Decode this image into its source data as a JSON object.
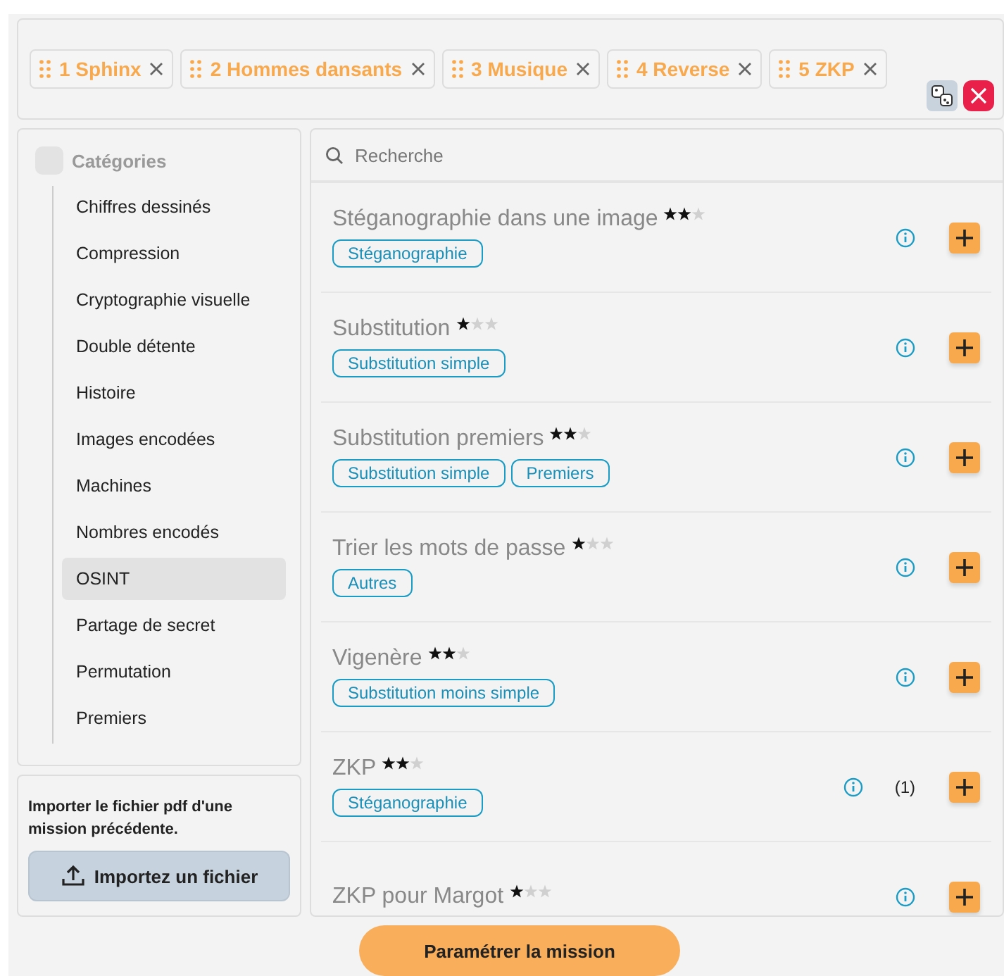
{
  "missions": [
    {
      "label": "1 Sphinx"
    },
    {
      "label": "2 Hommes dansants"
    },
    {
      "label": "3 Musique"
    },
    {
      "label": "4 Reverse"
    },
    {
      "label": "5 ZKP"
    }
  ],
  "categories": {
    "title": "Catégories",
    "checked": false,
    "items": [
      {
        "label": "Chiffres dessinés",
        "selected": false
      },
      {
        "label": "Compression",
        "selected": false
      },
      {
        "label": "Cryptographie visuelle",
        "selected": false
      },
      {
        "label": "Double détente",
        "selected": false
      },
      {
        "label": "Histoire",
        "selected": false
      },
      {
        "label": "Images encodées",
        "selected": false
      },
      {
        "label": "Machines",
        "selected": false
      },
      {
        "label": "Nombres encodés",
        "selected": false
      },
      {
        "label": "OSINT",
        "selected": true
      },
      {
        "label": "Partage de secret",
        "selected": false
      },
      {
        "label": "Permutation",
        "selected": false
      },
      {
        "label": "Premiers",
        "selected": false
      }
    ]
  },
  "import": {
    "text": "Importer le fichier pdf d'une mission précédente.",
    "button": "Importez un fichier"
  },
  "search": {
    "placeholder": "Recherche"
  },
  "challenges": [
    {
      "title": "Stéganographie dans une image",
      "stars": 2,
      "tags": [
        "Stéganographie"
      ]
    },
    {
      "title": "Substitution",
      "stars": 1,
      "tags": [
        "Substitution simple"
      ]
    },
    {
      "title": "Substitution premiers",
      "stars": 2,
      "tags": [
        "Substitution simple",
        "Premiers"
      ]
    },
    {
      "title": "Trier les mots de passe",
      "stars": 1,
      "tags": [
        "Autres"
      ]
    },
    {
      "title": "Vigenère",
      "stars": 2,
      "tags": [
        "Substitution moins simple"
      ]
    },
    {
      "title": "ZKP",
      "stars": 2,
      "tags": [
        "Stéganographie"
      ],
      "count": "(1)"
    },
    {
      "title": "ZKP pour Margot",
      "stars": 1
    }
  ],
  "primary_button": "Paramétrer la mission"
}
